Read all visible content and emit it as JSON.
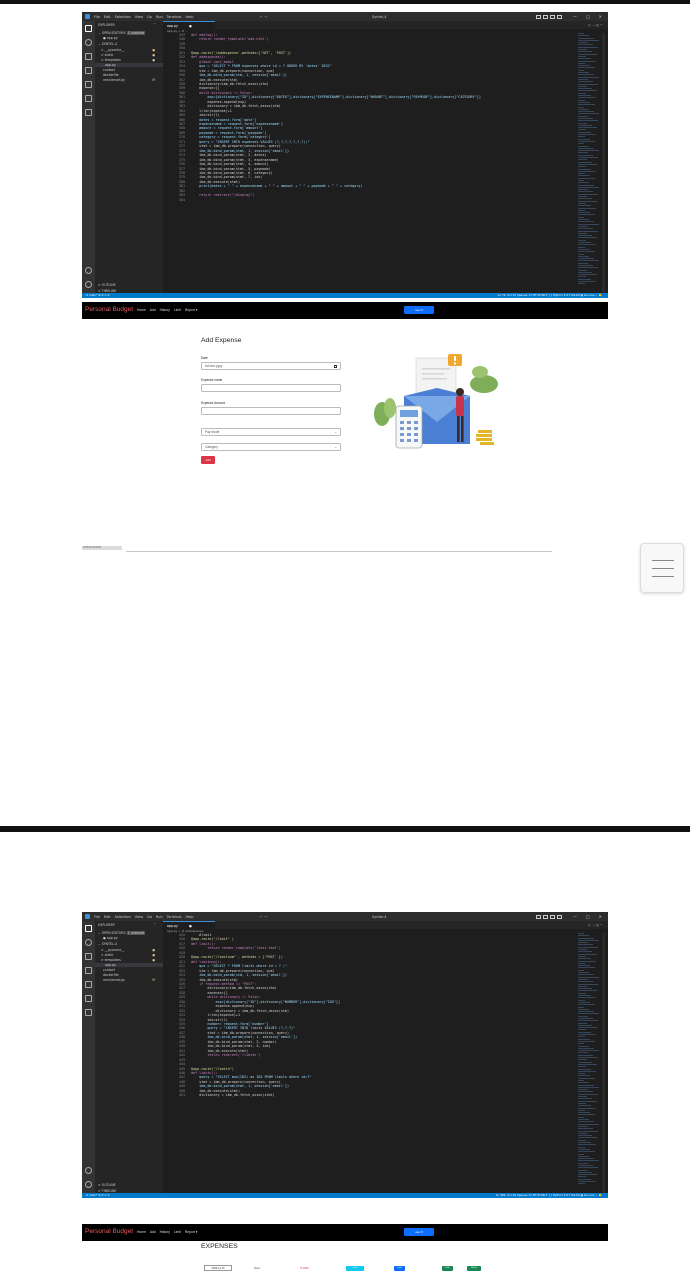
{
  "screenshot1": {
    "vscode": {
      "menu": [
        "File",
        "Edit",
        "Selection",
        "View",
        "Go",
        "Run",
        "Terminal",
        "Help"
      ],
      "nav": "←  →",
      "window_title": "Syntel-4",
      "window_buttons": [
        "—",
        "□",
        "✕"
      ],
      "explorer": {
        "header": "EXPLORER",
        "dots": "···",
        "open_editors": "OPEN EDITORS",
        "open_editors_badge": "1 unsaved",
        "open_file": "● app.py",
        "project": "SYNTEL-4",
        "items": [
          {
            "label": "> __pycache__",
            "marker": "●"
          },
          {
            "label": "> static",
            "marker": "●"
          },
          {
            "label": "> templates",
            "marker": "●"
          },
          {
            "label": "app.py",
            "marker": ""
          },
          {
            "label": "contact",
            "marker": ""
          },
          {
            "label": "dockerfile",
            "marker": ""
          },
          {
            "label": "venv/enraf.py",
            "marker": "M"
          }
        ],
        "outline": "> OUTLINE",
        "timeline": "> TIMELINE"
      },
      "tab": "app.py",
      "tab_unsaved": "●",
      "editor_actions": "▷ ⌄ ◫ ···",
      "breadcrumb": "app.py > ⊘ ...",
      "code": [
        {
          "n": "347",
          "t": "def addlog():"
        },
        {
          "n": "348",
          "t": "    return render_template('add.html')"
        },
        {
          "n": "349",
          "t": ""
        },
        {
          "n": "350",
          "t": ""
        },
        {
          "n": "351",
          "t": "@app.route('/addexpense',methods=['GET', 'POST'])"
        },
        {
          "n": "352",
          "t": "def addexpense():"
        },
        {
          "n": "353",
          "t": "    global user_email"
        },
        {
          "n": "354",
          "t": "    que = \"SELECT * FROM expenses where id = ? ORDER BY 'dates' DESC\""
        },
        {
          "n": "355",
          "t": "    stm = ibm_db.prepare(connection, que)"
        },
        {
          "n": "356",
          "t": "    ibm_db.bind_param(stm, 1, session['email'])"
        },
        {
          "n": "357",
          "t": "    ibm_db.execute(stm)"
        },
        {
          "n": "358",
          "t": "    dictionary=ibm_db.fetch_assoc(stm)"
        },
        {
          "n": "359",
          "t": "    expense=[]"
        },
        {
          "n": "360",
          "t": "    while dictionary != False:"
        },
        {
          "n": "361",
          "t": "        exp=[dictionary[\"ID\"],dictionary[\"DATES\"],dictionary[\"EXPENSENAME\"],dictionary[\"AMOUNT\"],dictionary[\"PAYMODE\"],dictionary[\"CATEGORY\"]]"
        },
        {
          "n": "362",
          "t": "        expense.append(exp)"
        },
        {
          "n": "363",
          "t": "        dictionary = ibm_db.fetch_assoc(stm)"
        },
        {
          "n": "364",
          "t": "    l=len(expense)+1"
        },
        {
          "n": "365",
          "t": "    idx=str(l)"
        },
        {
          "n": "366",
          "t": "    dates = request.form['date']"
        },
        {
          "n": "367",
          "t": "    expensename = request.form['expensename']"
        },
        {
          "n": "368",
          "t": "    amount = request.form['amount']"
        },
        {
          "n": "369",
          "t": "    paymode = request.form['paymode']"
        },
        {
          "n": "370",
          "t": "    category = request.form['category']"
        },
        {
          "n": "371",
          "t": "    query = \"INSERT INTO expenses VALUES (?,?,?,?,?,?,?);\""
        },
        {
          "n": "372",
          "t": "    stmt = ibm_db.prepare(connection, query)"
        },
        {
          "n": "373",
          "t": "    ibm_db.bind_param(stmt, 1, session['email'])"
        },
        {
          "n": "374",
          "t": "    ibm_db.bind_param(stmt, 2, dates)"
        },
        {
          "n": "375",
          "t": "    ibm_db.bind_param(stmt, 3, expensename)"
        },
        {
          "n": "376",
          "t": "    ibm_db.bind_param(stmt, 4, amount)"
        },
        {
          "n": "377",
          "t": "    ibm_db.bind_param(stmt, 5, paymode)"
        },
        {
          "n": "378",
          "t": "    ibm_db.bind_param(stmt, 6, category)"
        },
        {
          "n": "379",
          "t": "    ibm_db.bind_param(stmt, 7, idx)"
        },
        {
          "n": "380",
          "t": "    ibm_db.execute(stmt)"
        },
        {
          "n": "381",
          "t": "    print(dates + \" \" + expensename + \" \" + amount + \" \" + paymode + \" \" + category)"
        },
        {
          "n": "382",
          "t": ""
        },
        {
          "n": "383",
          "t": "    return redirect(\"/display\")"
        },
        {
          "n": "384",
          "t": ""
        }
      ],
      "status_left": "⎇ main*  ⊗ 0 ⚠ 0",
      "status_right": "Ln 72, Col 15   Spaces: 4   UTF-8   CRLF   {} Python   3.9.7 64-bit   ◉ Go Live   ✓   🔔"
    },
    "app": {
      "brand": "Personal Budget",
      "nav_links": [
        "Home",
        "Add",
        "History",
        "Limit",
        "Report ▾"
      ],
      "user_button": "user ▾",
      "form": {
        "title": "Add Expense",
        "date_label": "Date",
        "date_placeholder": "dd-mm-yyyy",
        "name_label": "Expense name",
        "amount_label": "Expense Amount",
        "paymode_value": "Pay Mode",
        "category_value": "Category",
        "add_button": "Add"
      },
      "strip_label": "1876X1130/1400",
      "colors": {
        "brand": "#e85a5a",
        "primary": "#0d6efd",
        "danger": "#dc3545",
        "status_bar": "#007acc"
      }
    }
  },
  "screenshot2": {
    "vscode": {
      "window_title": "Syntel-4",
      "breadcrumb": "app.py > ⊘ addexpense",
      "code": [
        {
          "n": "415",
          "t": "    #limit"
        },
        {
          "n": "416",
          "t": "@app.route(\"/limit\" )"
        },
        {
          "n": "417",
          "t": "def limit():"
        },
        {
          "n": "418",
          "t": "        return render_template('limit.html')"
        },
        {
          "n": "419",
          "t": ""
        },
        {
          "n": "420",
          "t": "@app.route(\"/limitnum\" , methods = ['POST' ])"
        },
        {
          "n": "421",
          "t": "def limitnum():"
        },
        {
          "n": "422",
          "t": "    que = \"SELECT * FROM limits where id = ? ;\""
        },
        {
          "n": "423",
          "t": "    stm = ibm_db.prepare(connection, que)"
        },
        {
          "n": "424",
          "t": "    ibm_db.bind_param(stm, 1, session['email'])"
        },
        {
          "n": "425",
          "t": "    ibm_db.execute(stm)"
        },
        {
          "n": "426",
          "t": "    if request.method == \"POST\":"
        },
        {
          "n": "427",
          "t": "        dictionary=ibm_db.fetch_assoc(stm)"
        },
        {
          "n": "428",
          "t": "        expense=[]"
        },
        {
          "n": "429",
          "t": "        while dictionary != False:"
        },
        {
          "n": "430",
          "t": "            exp=[dictionary[\"ID\"],dictionary[\"NUMBER\"],dictionary[\"IDX\"]]"
        },
        {
          "n": "431",
          "t": "            expense.append(exp)"
        },
        {
          "n": "432",
          "t": "            dictionary = ibm_db.fetch_assoc(stm)"
        },
        {
          "n": "433",
          "t": "        l=len(expense)+1"
        },
        {
          "n": "434",
          "t": "        idx=str(l)"
        },
        {
          "n": "435",
          "t": "        number= request.form['number']"
        },
        {
          "n": "436",
          "t": "        query = \"INSERT INTO limits VALUES (?,?,?)\""
        },
        {
          "n": "437",
          "t": "        stmt = ibm_db.prepare(connection, query)"
        },
        {
          "n": "438",
          "t": "        ibm_db.bind_param(stmt, 1, session['email'])"
        },
        {
          "n": "439",
          "t": "        ibm_db.bind_param(stmt, 2, number)"
        },
        {
          "n": "440",
          "t": "        ibm_db.bind_param(stmt, 3, idx)"
        },
        {
          "n": "441",
          "t": "        ibm_db.execute(stmt)"
        },
        {
          "n": "442",
          "t": "        return redirect('/limitn')"
        },
        {
          "n": "443",
          "t": ""
        },
        {
          "n": "444",
          "t": ""
        },
        {
          "n": "445",
          "t": "@app.route(\"/limitn\")"
        },
        {
          "n": "446",
          "t": "def limitn():"
        },
        {
          "n": "447",
          "t": "    query = \"SELECT max(IDX) as IDX FROM limits where id=?\""
        },
        {
          "n": "448",
          "t": "    stmt = ibm_db.prepare(connection, query)"
        },
        {
          "n": "449",
          "t": "    ibm_db.bind_param(stmt, 1, session['email'])"
        },
        {
          "n": "450",
          "t": "    ibm_db.execute(stmt)"
        },
        {
          "n": "451",
          "t": "    dictionary = ibm_db.fetch_assoc(stmt)"
        }
      ],
      "status_right": "Ln 381, Col 19   Spaces: 4   UTF-8   CRLF   {} Python   3.9.7 64-bit   ◉ Go Live   ✓   🔔"
    },
    "app": {
      "brand": "Personal Budget",
      "nav_links": [
        "Home",
        "Add",
        "History",
        "Limit",
        "Report ▾"
      ],
      "user_button": "user ▾",
      "expenses_title": "EXPENSES",
      "row": {
        "date": "2022-11-15",
        "name": "food",
        "amount": "₹ 2000",
        "paymode": "cash",
        "category": "food",
        "edit": "Edit",
        "delete": "Delete"
      }
    }
  }
}
